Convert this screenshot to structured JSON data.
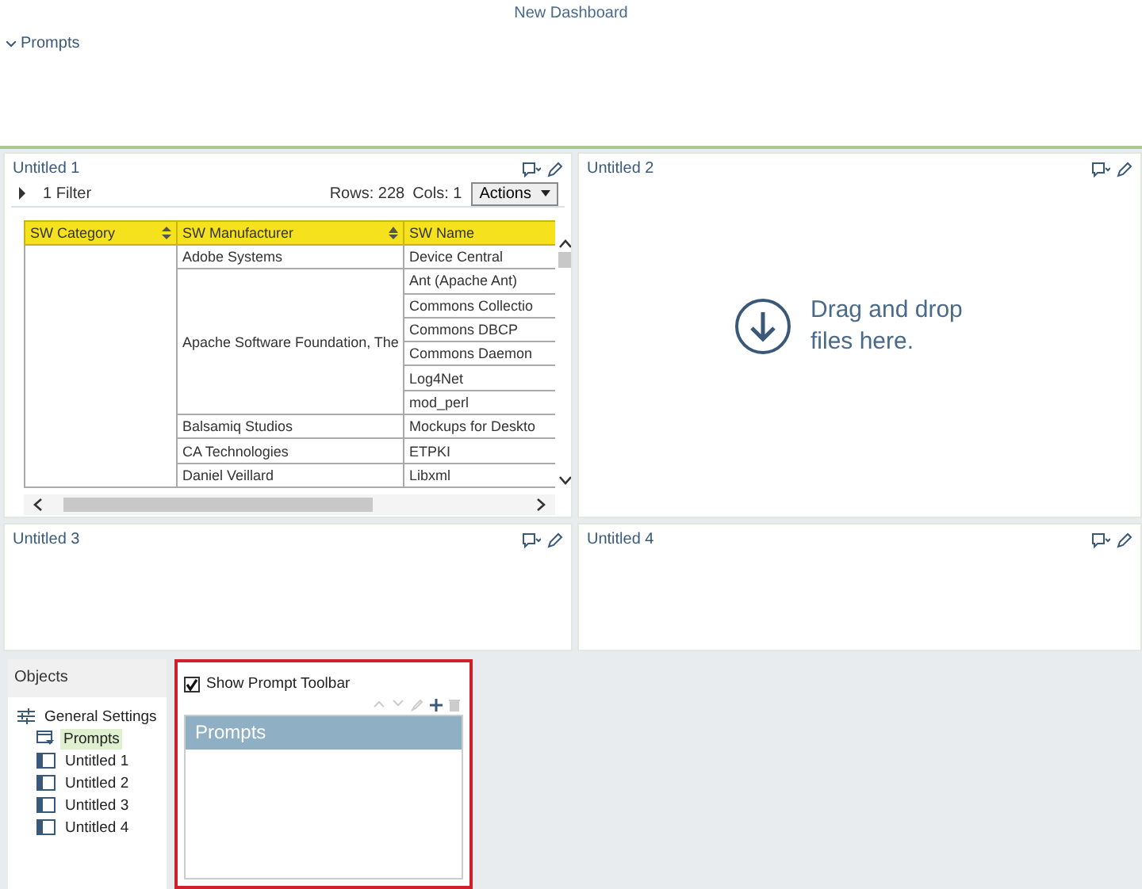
{
  "dashboard": {
    "title": "New Dashboard",
    "prompts_section": {
      "label": "Prompts",
      "expanded": true
    }
  },
  "panels": [
    {
      "title": "Untitled 1",
      "kind": "grid",
      "filter": {
        "label": "1 Filter",
        "expanded": false
      },
      "rows_count": "Rows: 228",
      "cols_count": "Cols: 1",
      "actions": "Actions",
      "table": {
        "columns": [
          "SW Category",
          "SW Manufacturer",
          "SW Name"
        ],
        "groups": [
          {
            "manufacturer": "Adobe Systems",
            "names": [
              "Device Central"
            ]
          },
          {
            "manufacturer": "Apache Software Foundation, The",
            "names": [
              "Ant (Apache Ant)",
              "Commons Collectio",
              "Commons DBCP",
              "Commons Daemon",
              "Log4Net",
              "mod_perl"
            ]
          },
          {
            "manufacturer": "Balsamiq Studios",
            "names": [
              "Mockups for Deskto"
            ]
          },
          {
            "manufacturer": "CA Technologies",
            "names": [
              "ETPKI"
            ]
          },
          {
            "manufacturer": "Daniel Veillard",
            "names": [
              "Libxml"
            ]
          }
        ]
      }
    },
    {
      "title": "Untitled 2",
      "kind": "dropzone",
      "message": "Drag and drop files here."
    },
    {
      "title": "Untitled 3",
      "kind": "empty"
    },
    {
      "title": "Untitled 4",
      "kind": "empty"
    }
  ],
  "objects": {
    "title": "Objects",
    "tree": [
      {
        "label": "General Settings",
        "kind": "settings",
        "selected": false,
        "children": [
          {
            "label": "Prompts",
            "kind": "prompt",
            "selected": true
          },
          {
            "label": "Untitled 1",
            "kind": "panel",
            "selected": false
          },
          {
            "label": "Untitled 2",
            "kind": "panel",
            "selected": false
          },
          {
            "label": "Untitled 3",
            "kind": "panel",
            "selected": false
          },
          {
            "label": "Untitled 4",
            "kind": "panel",
            "selected": false
          }
        ]
      }
    ]
  },
  "prompt_settings": {
    "show_toolbar": {
      "label": "Show Prompt Toolbar",
      "checked": true
    },
    "list_header": "Prompts"
  }
}
